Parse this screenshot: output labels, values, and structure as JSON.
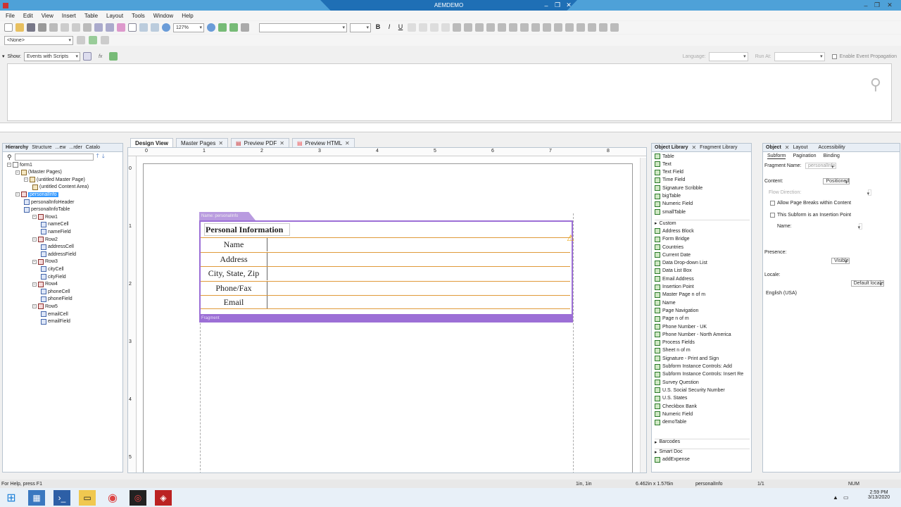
{
  "app": {
    "title": "AEMDEMO"
  },
  "menu": [
    "File",
    "Edit",
    "View",
    "Insert",
    "Table",
    "Layout",
    "Tools",
    "Window",
    "Help"
  ],
  "toolbar": {
    "zoom": "127%"
  },
  "toolbar2": {
    "none_select": "<None>"
  },
  "scriptbar": {
    "show_label": "Show:",
    "show_value": "Events with Scripts",
    "language_label": "Language:",
    "runat_label": "Run At:",
    "propagation_label": "Enable Event Propagation"
  },
  "hierarchy": {
    "tabs": [
      "Hierarchy",
      "Structure",
      "...ew",
      "...rder",
      "Catalo"
    ],
    "items": [
      {
        "label": "form1",
        "indent": 0,
        "icon": "form"
      },
      {
        "label": "(Master Pages)",
        "indent": 1,
        "icon": "page"
      },
      {
        "label": "(untitled Master Page)",
        "indent": 2,
        "icon": "page"
      },
      {
        "label": "(untitled Content Area)",
        "indent": 3,
        "icon": "page"
      },
      {
        "label": "personalInfo",
        "indent": 1,
        "icon": "sub",
        "selected": true
      },
      {
        "label": "personalInfoHeader",
        "indent": 2,
        "icon": "field"
      },
      {
        "label": "personalInfoTable",
        "indent": 2,
        "icon": "field"
      },
      {
        "label": "Row1",
        "indent": 3,
        "icon": "sub"
      },
      {
        "label": "nameCell",
        "indent": 4,
        "icon": "field"
      },
      {
        "label": "nameField",
        "indent": 4,
        "icon": "field"
      },
      {
        "label": "Row2",
        "indent": 3,
        "icon": "sub"
      },
      {
        "label": "addressCell",
        "indent": 4,
        "icon": "field"
      },
      {
        "label": "addressField",
        "indent": 4,
        "icon": "field"
      },
      {
        "label": "Row3",
        "indent": 3,
        "icon": "sub"
      },
      {
        "label": "cityCell",
        "indent": 4,
        "icon": "field"
      },
      {
        "label": "cityField",
        "indent": 4,
        "icon": "field"
      },
      {
        "label": "Row4",
        "indent": 3,
        "icon": "sub"
      },
      {
        "label": "phoneCell",
        "indent": 4,
        "icon": "field"
      },
      {
        "label": "phoneField",
        "indent": 4,
        "icon": "field"
      },
      {
        "label": "Row5",
        "indent": 3,
        "icon": "sub"
      },
      {
        "label": "emailCell",
        "indent": 4,
        "icon": "field"
      },
      {
        "label": "emailField",
        "indent": 4,
        "icon": "field"
      }
    ]
  },
  "doctabs": [
    "Design View",
    "Master Pages",
    "Preview PDF",
    "Preview HTML"
  ],
  "ruler": {
    "h": [
      "0",
      "1",
      "2",
      "3",
      "4",
      "5",
      "6",
      "7",
      "8"
    ],
    "v": [
      "0",
      "1",
      "2",
      "3",
      "4",
      "5"
    ]
  },
  "form": {
    "subform_name": "Name: personalInfo",
    "header": "Personal Information",
    "rows": [
      "Name",
      "Address",
      "City, State, Zip",
      "Phone/Fax",
      "Email"
    ],
    "fragment_label": "Fragment"
  },
  "objlib": {
    "tabs": [
      "Object Library",
      "Fragment Library"
    ],
    "top_items": [
      "Table",
      "Text",
      "Text Field",
      "Time Field",
      "Signature Scribble",
      "bigTable",
      "Numeric Field",
      "smallTable"
    ],
    "custom_label": "Custom",
    "custom_items": [
      "Address Block",
      "Form Bridge",
      "Countries",
      "Current Date",
      "Data Drop-down List",
      "Data List Box",
      "Email Address",
      "Insertion Point",
      "Master Page n of m",
      "Name",
      "Page Navigation",
      "Page n of m",
      "Phone Number - UK",
      "Phone Number - North America",
      "Process Fields",
      "Sheet n of m",
      "Signature - Print and Sign",
      "Subform Instance Controls: Add",
      "Subform Instance Controls: Insert Re",
      "Survey Question",
      "U.S. Social Security Number",
      "U.S. States",
      "Checkbox Bank",
      "Numeric Field",
      "demoTable"
    ],
    "barcodes_label": "Barcodes",
    "smartdoc_label": "Smart Doc",
    "smartdoc_items": [
      "addExpense"
    ]
  },
  "objpanel": {
    "tabs": [
      "Object",
      "Layout",
      "Accessibility"
    ],
    "subtabs": [
      "Subform",
      "Pagination",
      "Binding"
    ],
    "fragment_name_label": "Fragment Name:",
    "fragment_name_value": "personalInfo",
    "content_label": "Content:",
    "content_value": "Positioned",
    "flow_label": "Flow Direction:",
    "allow_breaks": "Allow Page Breaks within Content",
    "insertion_point": "This Subform is an Insertion Point",
    "name_label": "Name:",
    "presence_label": "Presence:",
    "presence_value": "Visible",
    "locale_label": "Locale:",
    "locale_value": "Default locale",
    "locale_sub": "English (USA)"
  },
  "status": {
    "help": "For Help, press F1",
    "position": "1in, 1in",
    "size": "6.462in x 1.576in",
    "object": "personalInfo",
    "page": "1/1",
    "num": "NUM"
  },
  "taskbar": {
    "time": "2:59 PM",
    "date": "3/13/2020"
  }
}
